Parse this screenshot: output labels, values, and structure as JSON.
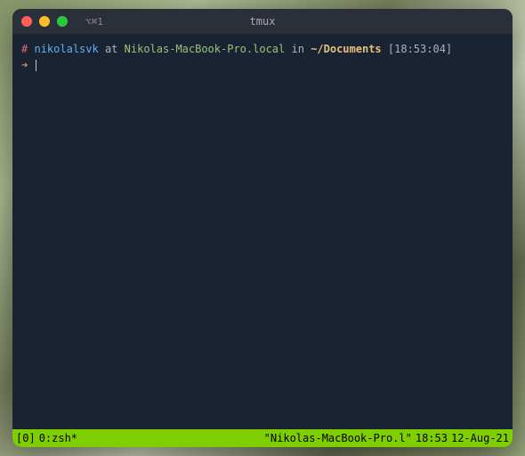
{
  "titlebar": {
    "tab_label": "⌥⌘1",
    "window_title": "tmux"
  },
  "prompt": {
    "hash": "#",
    "user": "nikolalsvk",
    "at": "at",
    "host": "Nikolas-MacBook-Pro.local",
    "in": "in",
    "path": "~/Documents",
    "time": "[18:53:04]",
    "arrow": "➜"
  },
  "statusbar": {
    "session": "[0]",
    "window": "0:zsh*",
    "hostname": "\"Nikolas-MacBook-Pro.l\"",
    "clock": "18:53",
    "date": "12-Aug-21"
  }
}
